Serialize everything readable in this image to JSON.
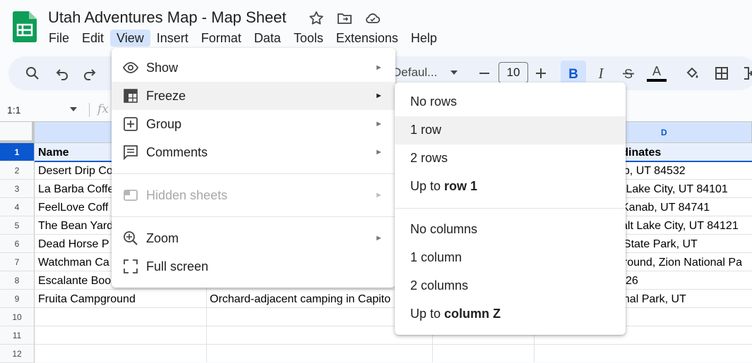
{
  "header": {
    "title": "Utah Adventures Map - Map Sheet",
    "menus": [
      "File",
      "Edit",
      "View",
      "Insert",
      "Format",
      "Data",
      "Tools",
      "Extensions",
      "Help"
    ],
    "active_menu": "View"
  },
  "toolbar": {
    "font_name": "Defaul...",
    "font_size": "10",
    "bold_active": true,
    "icons": [
      "search-icon",
      "undo-icon",
      "redo-icon",
      "minus-icon",
      "plus-icon",
      "bold-icon",
      "italic-icon",
      "strikethrough-icon",
      "text-color-icon",
      "fill-color-icon",
      "borders-icon",
      "merge-icon"
    ],
    "text_color": "#000000"
  },
  "formula_bar": {
    "name_box": "1:1",
    "fx": "fx"
  },
  "grid": {
    "column_letters": [
      "D"
    ],
    "row_numbers": [
      "1",
      "2",
      "3",
      "4",
      "5",
      "6",
      "7",
      "8",
      "9",
      "10",
      "11",
      "12"
    ],
    "col_a": [
      "Name",
      "Desert Drip Co",
      "La Barba Coffe",
      "FeelLove Coff",
      "The Bean Yard",
      "Dead Horse P",
      "Watchman Ca",
      "Escalante Boo",
      "Fruita Campground"
    ],
    "col_b": [
      "",
      "",
      "",
      "",
      "",
      "",
      "",
      "",
      "Orchard-adjacent camping in Capito"
    ],
    "col_d": [
      "rdinates",
      "ab, UT 84532",
      "lt Lake City, UT 84101",
      "Kanab, UT 84741",
      "alt Lake City, UT 84121",
      "t State Park, UT",
      "ground, Zion National Pa",
      "26",
      "onal Park, UT"
    ]
  },
  "view_menu": {
    "items": [
      {
        "label": "Show",
        "icon": "eye-icon",
        "submenu": true
      },
      {
        "label": "Freeze",
        "icon": "freeze-icon",
        "submenu": true
      },
      {
        "label": "Group",
        "icon": "group-plus-icon",
        "submenu": true
      },
      {
        "label": "Comments",
        "icon": "comments-icon",
        "submenu": true
      },
      {
        "label": "Hidden sheets",
        "icon": "hidden-sheet-icon",
        "submenu": true,
        "disabled": true
      },
      {
        "label": "Zoom",
        "icon": "zoom-icon",
        "submenu": true
      },
      {
        "label": "Full screen",
        "icon": "fullscreen-icon",
        "submenu": false
      }
    ],
    "arrow": "►"
  },
  "freeze_menu": {
    "no_rows": "No rows",
    "one_row": "1 row",
    "two_rows": "2 rows",
    "up_to_row_prefix": "Up to ",
    "up_to_row_bold": "row 1",
    "no_columns": "No columns",
    "one_column": "1 column",
    "two_columns": "2 columns",
    "up_to_column_prefix": "Up to ",
    "up_to_column_bold": "column Z"
  },
  "colors": {
    "accent": "#0b57d0",
    "selection": "#d3e3fd",
    "logo_green": "#0f9d58"
  }
}
